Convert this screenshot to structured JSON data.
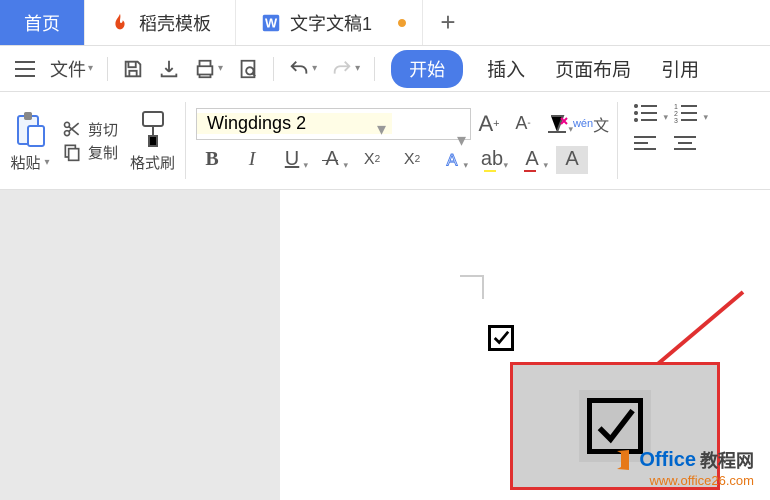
{
  "tabs": {
    "home": "首页",
    "shell": "稻壳模板",
    "doc": "文字文稿1"
  },
  "menubar": {
    "file": "文件",
    "start": "开始",
    "insert": "插入",
    "pagelayout": "页面布局",
    "reference": "引用"
  },
  "ribbon": {
    "paste": "粘贴",
    "cut": "剪切",
    "copy": "复制",
    "formatpainter": "格式刷",
    "fontname": "Wingdings 2",
    "fontsize": ""
  },
  "watermark": {
    "brand_en": "Office",
    "brand_cn": "教程网",
    "url": "www.office26.com"
  }
}
